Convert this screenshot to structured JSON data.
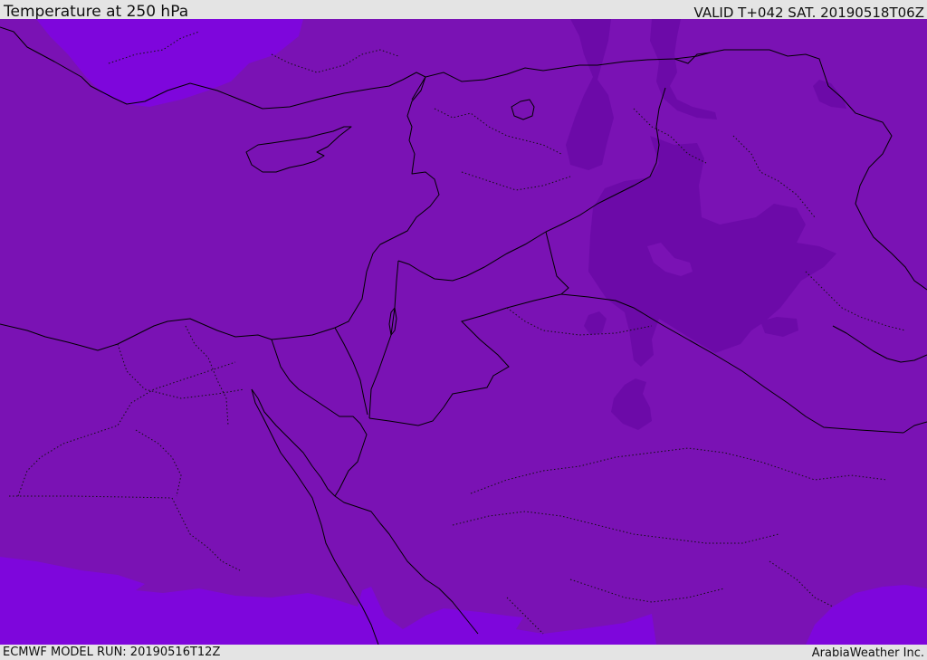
{
  "header": {
    "title": "Temperature at 250 hPa",
    "valid_time": "VALID T+042 SAT. 20190518T06Z"
  },
  "footer": {
    "model_run": "ECMWF MODEL RUN: 20190516T12Z",
    "credit": "ArabiaWeather Inc."
  },
  "map": {
    "field": "temperature",
    "level": "250 hPa",
    "colors": {
      "base_shade": "#7a12b4",
      "cold_shade": "#6c0aa8",
      "warm_shade": "#7e06dc",
      "coastline": "#000000",
      "border": "#000000"
    }
  }
}
